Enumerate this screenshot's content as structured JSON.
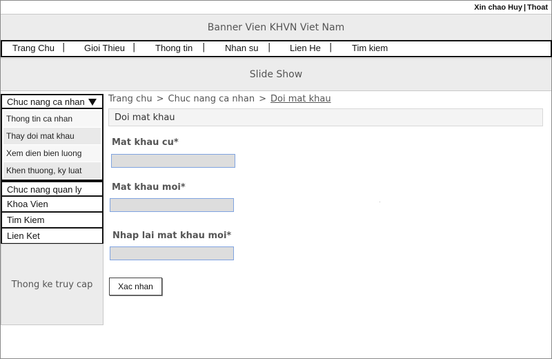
{
  "header": {
    "greeting": "Xin chao Huy",
    "separator": "|",
    "logout": "Thoat"
  },
  "banner": {
    "label": "Banner Vien KHVN Viet Nam"
  },
  "nav": {
    "items": [
      "Trang Chu",
      "Gioi Thieu",
      "Thong tin",
      "Nhan su",
      "Lien He",
      "Tim kiem"
    ],
    "separator": "|"
  },
  "slideshow": {
    "label": "Slide Show"
  },
  "sidebar": {
    "personal_menu": {
      "label": "Chuc nang ca nhan",
      "items": [
        "Thong tin ca nhan",
        "Thay doi mat khau",
        "Xem dien bien luong",
        "Khen thuong, ky luat"
      ]
    },
    "menus": [
      "Chuc nang quan ly",
      "Khoa Vien",
      "Tim Kiem",
      "Lien Ket"
    ],
    "stats_label": "Thong ke truy cap"
  },
  "breadcrumb": {
    "items": [
      "Trang chu",
      "Chuc nang ca nhan",
      "Doi mat khau"
    ],
    "separator": ">"
  },
  "form": {
    "title": "Doi mat khau",
    "old_password_label": "Mat khau cu*",
    "old_password_value": "",
    "new_password_label": "Mat khau moi*",
    "new_password_value": "",
    "confirm_password_label": "Nhap lai mat khau moi*",
    "confirm_password_value": "",
    "submit_label": "Xac nhan"
  },
  "colors": {
    "placeholder_bg": "#ececec",
    "input_bg": "#dddddd",
    "input_border": "#7fa3e0",
    "border": "#111111"
  }
}
